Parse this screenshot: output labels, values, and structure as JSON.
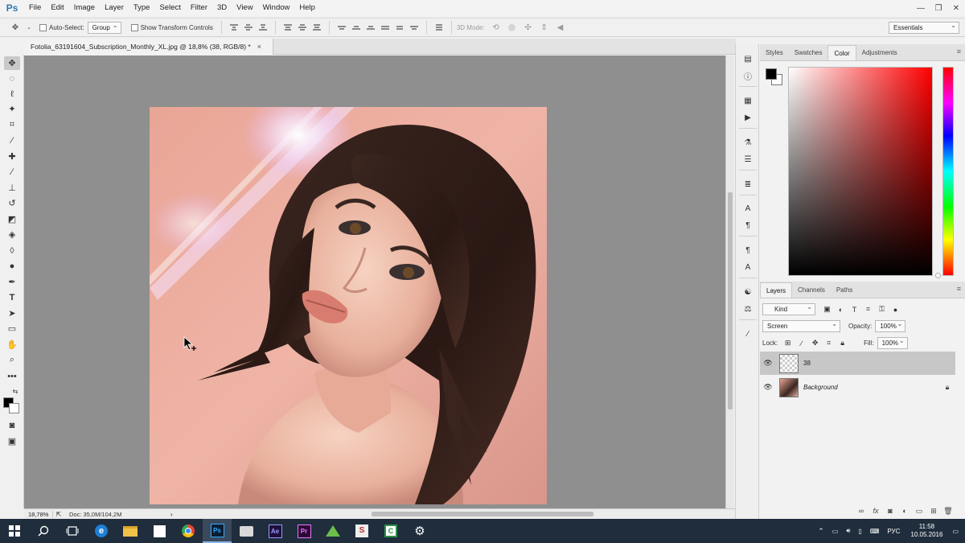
{
  "app": {
    "logo": "Ps"
  },
  "menu": [
    "File",
    "Edit",
    "Image",
    "Layer",
    "Type",
    "Select",
    "Filter",
    "3D",
    "View",
    "Window",
    "Help"
  ],
  "window_controls": {
    "minimize": "—",
    "restore": "❐",
    "close": "✕"
  },
  "options_bar": {
    "auto_select_label": "Auto-Select:",
    "auto_select_value": "Group",
    "transform_label": "Show Transform Controls",
    "mode_3d_label": "3D Mode:",
    "workspace": "Essentials"
  },
  "document_tab": {
    "title": "Fotolia_63191604_Subscription_Monthly_XL.jpg @ 18,8% (38, RGB/8) *",
    "close": "×"
  },
  "status": {
    "zoom": "18,78%",
    "doc": "Doc: 35,0M/104,2M"
  },
  "color_panel": {
    "tabs": [
      "Styles",
      "Swatches",
      "Color",
      "Adjustments"
    ],
    "active_tab": "Color",
    "foreground": "#000000",
    "background": "#ffffff"
  },
  "layers_panel": {
    "tabs": [
      "Layers",
      "Channels",
      "Paths"
    ],
    "active_tab": "Layers",
    "filter_kind": "Kind",
    "blend_mode": "Screen",
    "opacity_label": "Opacity:",
    "opacity_value": "100%",
    "lock_label": "Lock:",
    "fill_label": "Fill:",
    "fill_value": "100%",
    "layers": [
      {
        "name": "38",
        "selected": true
      },
      {
        "name": "Background",
        "selected": false
      }
    ]
  },
  "taskbar": {
    "apps": [
      "start",
      "search",
      "task-view",
      "edge",
      "explorer",
      "store",
      "chrome",
      "photoshop",
      "files",
      "after-effects",
      "premiere",
      "arrow-app",
      "app-s",
      "app-c",
      "settings"
    ],
    "language": "РУС",
    "time": "11:58",
    "date": "10.05.2016"
  }
}
